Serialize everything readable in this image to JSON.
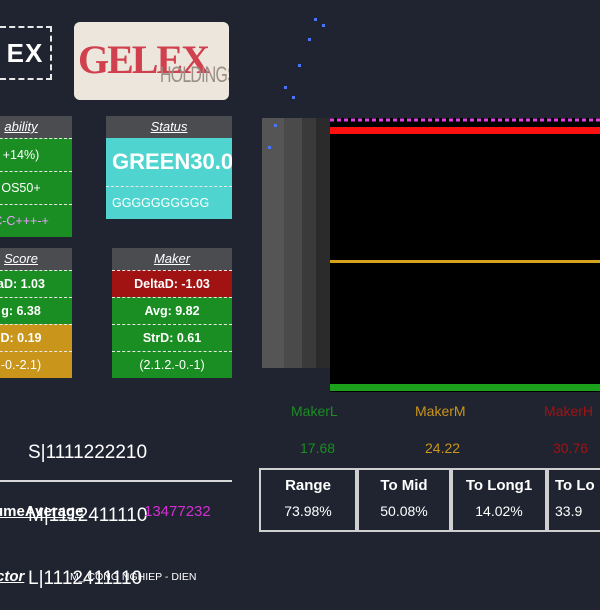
{
  "ticker": "EX",
  "logo": {
    "text_red": "GELEX",
    "text_grey": "HOLDINGS"
  },
  "stability": {
    "header": "ability",
    "rows": [
      "+14%)",
      "OS50+",
      "C-C+++-+"
    ]
  },
  "status": {
    "header": "Status",
    "main": "GREEN30.0",
    "sub": "GGGGGGGGGG"
  },
  "score": {
    "header": "Score",
    "rows": [
      "aD: 1.03",
      "g: 6.38",
      "D: 0.19",
      "-0.-2.1)"
    ]
  },
  "maker": {
    "header": "Maker",
    "rows": [
      "DeltaD: -1.03",
      "Avg: 9.82",
      "StrD: 0.61",
      "(2.1.2.-0.-1)"
    ]
  },
  "sml": {
    "s": "S|1111222210",
    "m": "M|1112411110",
    "l": "L|1112411110"
  },
  "volume": {
    "label": "umeAverage",
    "value": "13477232"
  },
  "sector": {
    "label": "ctor",
    "value": "M_ CONG NGHIEP - DIEN"
  },
  "makers": {
    "l_label": "MakerL",
    "m_label": "MakerM",
    "h_label": "MakerH",
    "l_value": "17.68",
    "m_value": "24.22",
    "h_value": "30.76"
  },
  "metrics": [
    {
      "title": "Range",
      "value": "73.98%"
    },
    {
      "title": "To Mid",
      "value": "50.08%"
    },
    {
      "title": "To Long1",
      "value": "14.02%"
    },
    {
      "title": "To Lo",
      "value": "33.9"
    }
  ],
  "colors": {
    "background": "#1f2430",
    "green": "#1a8e22",
    "red": "#a01312",
    "yellow": "#c9951a",
    "cyan": "#4fd4cf",
    "magenta": "#d230d2"
  }
}
